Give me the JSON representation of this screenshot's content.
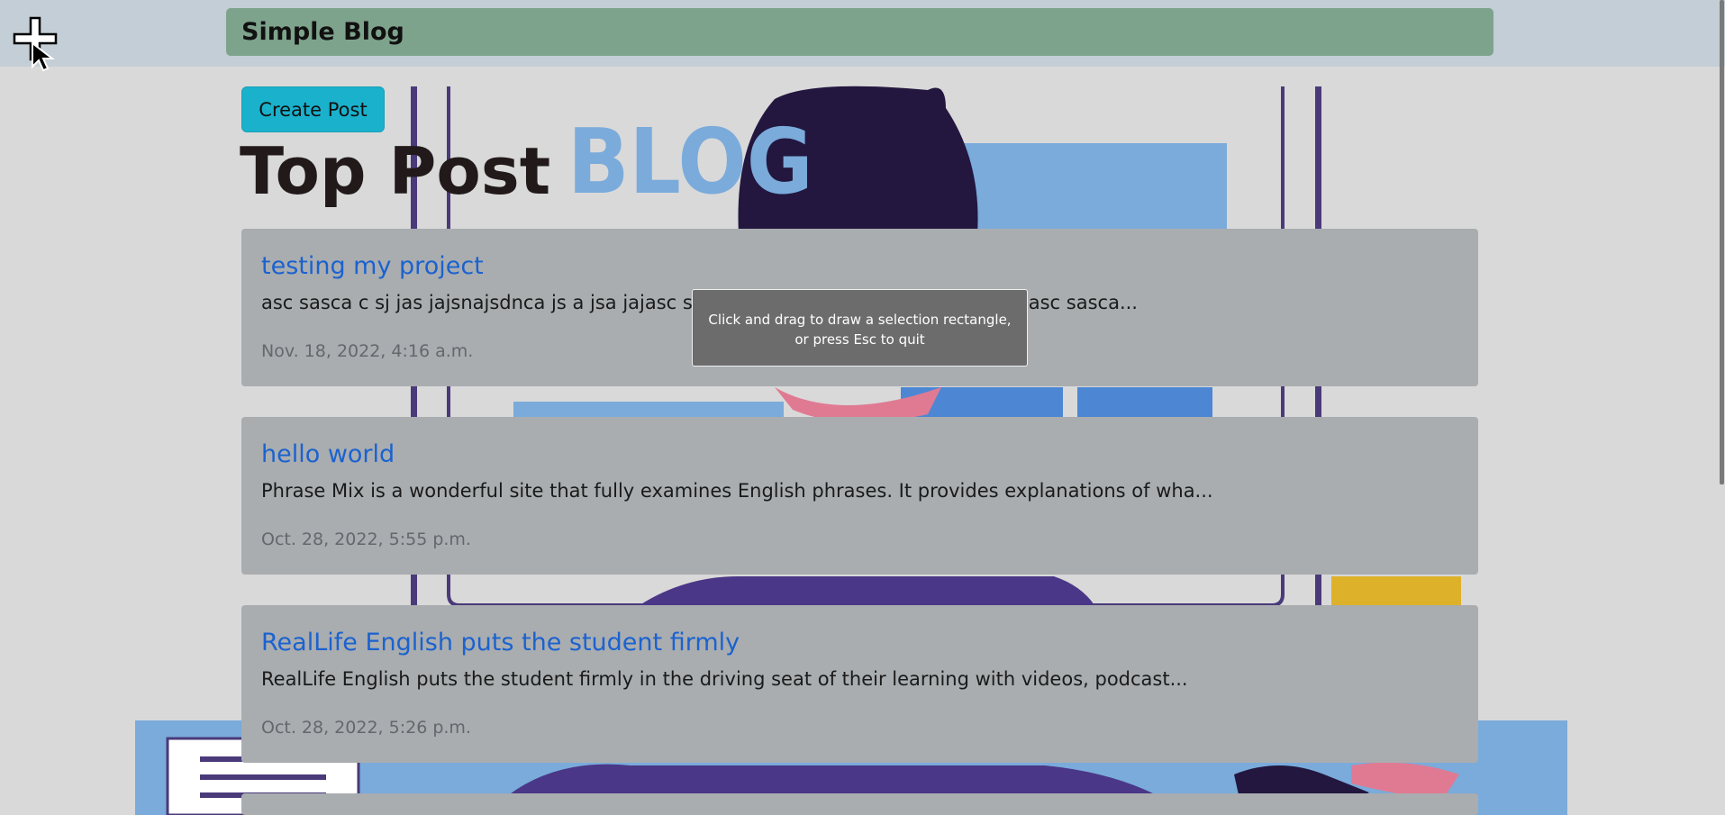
{
  "navbar": {
    "brand": "Simple Blog"
  },
  "actions": {
    "create_post_label": "Create Post"
  },
  "page": {
    "title": "Top Post"
  },
  "background": {
    "logo_text": "BLOG"
  },
  "posts": [
    {
      "title": "testing my project",
      "excerpt": "asc sasca c sj jas jajsnajsdnca js a jsa jajasc sasca c sj jas jajsnajsdnca js a jsa jajasc sasca...",
      "date": "Nov. 18, 2022, 4:16 a.m."
    },
    {
      "title": "hello world",
      "excerpt": "Phrase Mix is a wonderful site that fully examines English phrases. It provides explanations of wha...",
      "date": "Oct. 28, 2022, 5:55 p.m."
    },
    {
      "title": "RealLife English puts the student firmly",
      "excerpt": "RealLife English puts the student firmly in the driving seat of their learning with videos, podcast...",
      "date": "Oct. 28, 2022, 5:26 p.m."
    }
  ],
  "overlay": {
    "hint_line1": "Click and drag to draw a selection rectangle,",
    "hint_line2": "or press Esc to quit"
  },
  "icons": {
    "cursor": "crosshair-cursor-icon"
  },
  "colors": {
    "navbar": "#7ea38c",
    "create_button": "#1ab1cc",
    "link": "#1b62cf",
    "card": "#a9adb0"
  }
}
